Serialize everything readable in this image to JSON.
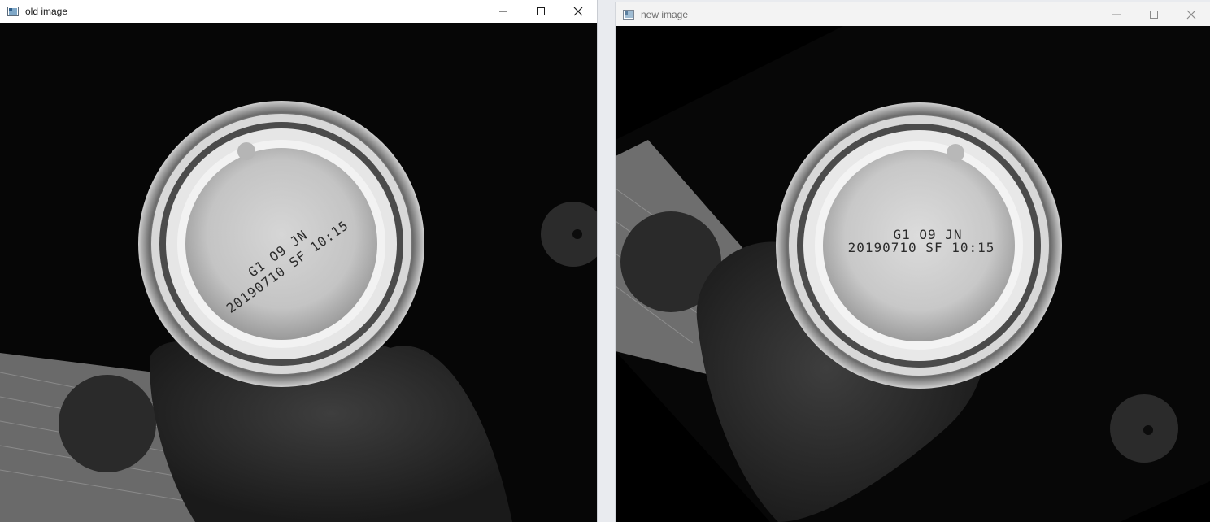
{
  "windows": [
    {
      "title": "old image",
      "icon": "opencv-window-icon",
      "controls": [
        "minimize-icon",
        "maximize-icon",
        "close-icon"
      ],
      "image": {
        "print_line1": "G1 O9  JN",
        "print_line2": "20190710 SF 10:15",
        "rotation_deg": -36
      }
    },
    {
      "title": "new image",
      "icon": "opencv-window-icon",
      "controls": [
        "minimize-icon",
        "maximize-icon",
        "close-icon"
      ],
      "image": {
        "print_line1": "G1 O9  JN",
        "print_line2": "20190710 SF 10:15",
        "rotation_deg": 0
      }
    }
  ],
  "colors": {
    "titlebar_active": "#ffffff",
    "titlebar_inactive": "#f3f3f3",
    "desktop_bg": "#e9ebef"
  }
}
